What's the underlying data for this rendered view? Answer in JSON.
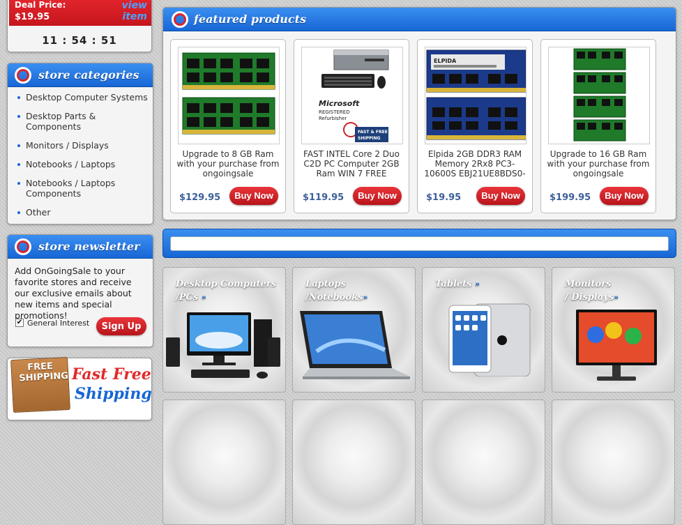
{
  "deal": {
    "price_label": "Deal Price:",
    "price": "$19.95",
    "view_item": "view item",
    "timer": "11 : 54 : 51"
  },
  "categories": {
    "title": "store categories",
    "items": [
      {
        "label": "Desktop Computer Systems"
      },
      {
        "label": "Desktop Parts & Components"
      },
      {
        "label": "Monitors / Displays"
      },
      {
        "label": "Notebooks / Laptops"
      },
      {
        "label": "Notebooks / Laptops Components"
      },
      {
        "label": "Other"
      }
    ]
  },
  "newsletter": {
    "title": "store newsletter",
    "text": "Add OnGoingSale to your favorite stores and receive our exclusive emails about new items and special promotions!",
    "checkbox_label": "General Interest",
    "checked": true,
    "button": "Sign Up"
  },
  "shipping": {
    "box_text": "FREE SHIPPING",
    "line1": "Fast Free",
    "line2": "Shipping"
  },
  "featured": {
    "title": "featured products",
    "products": [
      {
        "title": "Upgrade to 8 GB Ram with your purchase from ongoingsale",
        "price": "$129.95",
        "button": "Buy Now"
      },
      {
        "title": "FAST INTEL Core 2 Duo C2D PC Computer 2GB Ram WIN 7 FREE",
        "price": "$119.95",
        "button": "Buy Now"
      },
      {
        "title": "Elpida 2GB DDR3 RAM Memory 2Rx8 PC3-10600S EBJ21UE8BDS0-",
        "price": "$19.95",
        "button": "Buy Now"
      },
      {
        "title": "Upgrade to 16 GB Ram with your purchase from ongoingsale",
        "price": "$199.95",
        "button": "Buy Now"
      }
    ]
  },
  "pc_labels": {
    "microsoft": "Microsoft",
    "registered": "REGISTERED",
    "refurbisher": "Refurbisher",
    "fast_free": "FAST & FREE",
    "shipping": "SHIPPING"
  },
  "ram_label": "ELPIDA",
  "tiles": [
    {
      "line1": "Desktop Computers",
      "line2": "/PCs"
    },
    {
      "line1": "Laptops",
      "line2": "/Notebooks"
    },
    {
      "line1": "Tablets",
      "line2": ""
    },
    {
      "line1": "Monitors",
      "line2": "/ Displays"
    }
  ],
  "icons": {
    "arrow": "»"
  },
  "colors": {
    "brand_blue": "#1766d6",
    "brand_red": "#d8262c",
    "price_blue": "#3d5f99"
  }
}
